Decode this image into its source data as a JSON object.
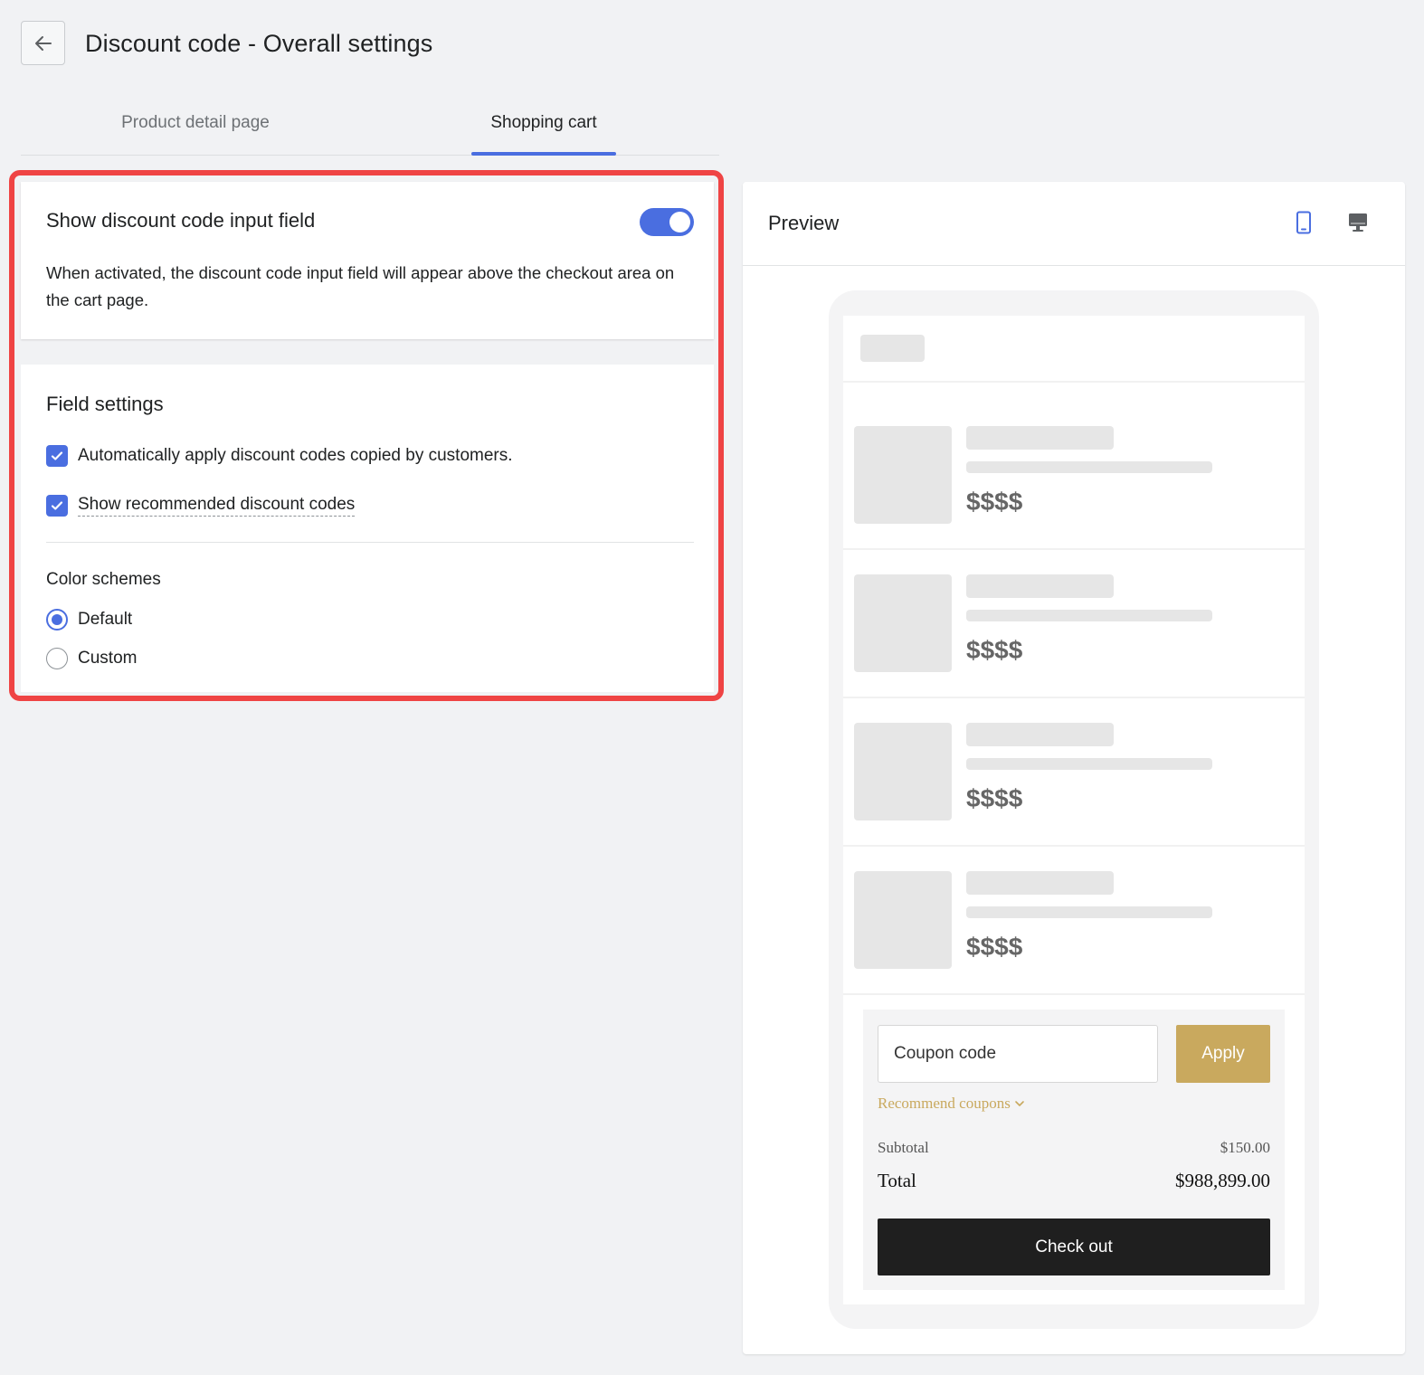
{
  "header": {
    "title": "Discount code - Overall settings",
    "back_icon": "arrow-left-icon"
  },
  "tabs": [
    {
      "label": "Product detail page",
      "active": false
    },
    {
      "label": "Shopping cart",
      "active": true
    }
  ],
  "toggle_card": {
    "title": "Show discount code input field",
    "enabled": true,
    "description": "When activated, the discount code input field will appear above the checkout area on the cart page."
  },
  "field_settings": {
    "title": "Field settings",
    "options": [
      {
        "label": "Automatically apply discount codes copied by customers.",
        "checked": true
      },
      {
        "label": "Show recommended discount codes",
        "checked": true
      }
    ],
    "color_schemes": {
      "title": "Color schemes",
      "options": [
        {
          "label": "Default",
          "selected": true
        },
        {
          "label": "Custom",
          "selected": false
        }
      ]
    }
  },
  "preview": {
    "title": "Preview",
    "device_icons": [
      "mobile-icon",
      "desktop-icon"
    ],
    "active_device": "mobile",
    "items": [
      {
        "price": "$$$$"
      },
      {
        "price": "$$$$"
      },
      {
        "price": "$$$$"
      },
      {
        "price": "$$$$"
      }
    ],
    "coupon_placeholder": "Coupon code",
    "apply_label": "Apply",
    "recommend_label": "Recommend coupons",
    "subtotal_label": "Subtotal",
    "subtotal_value": "$150.00",
    "total_label": "Total",
    "total_value": "$988,899.00",
    "checkout_label": "Check out"
  },
  "colors": {
    "accent": "#4a6ee0",
    "highlight_border": "#ef4444",
    "apply_gold": "#c9a95e",
    "checkout_dark": "#1f1f1f"
  }
}
